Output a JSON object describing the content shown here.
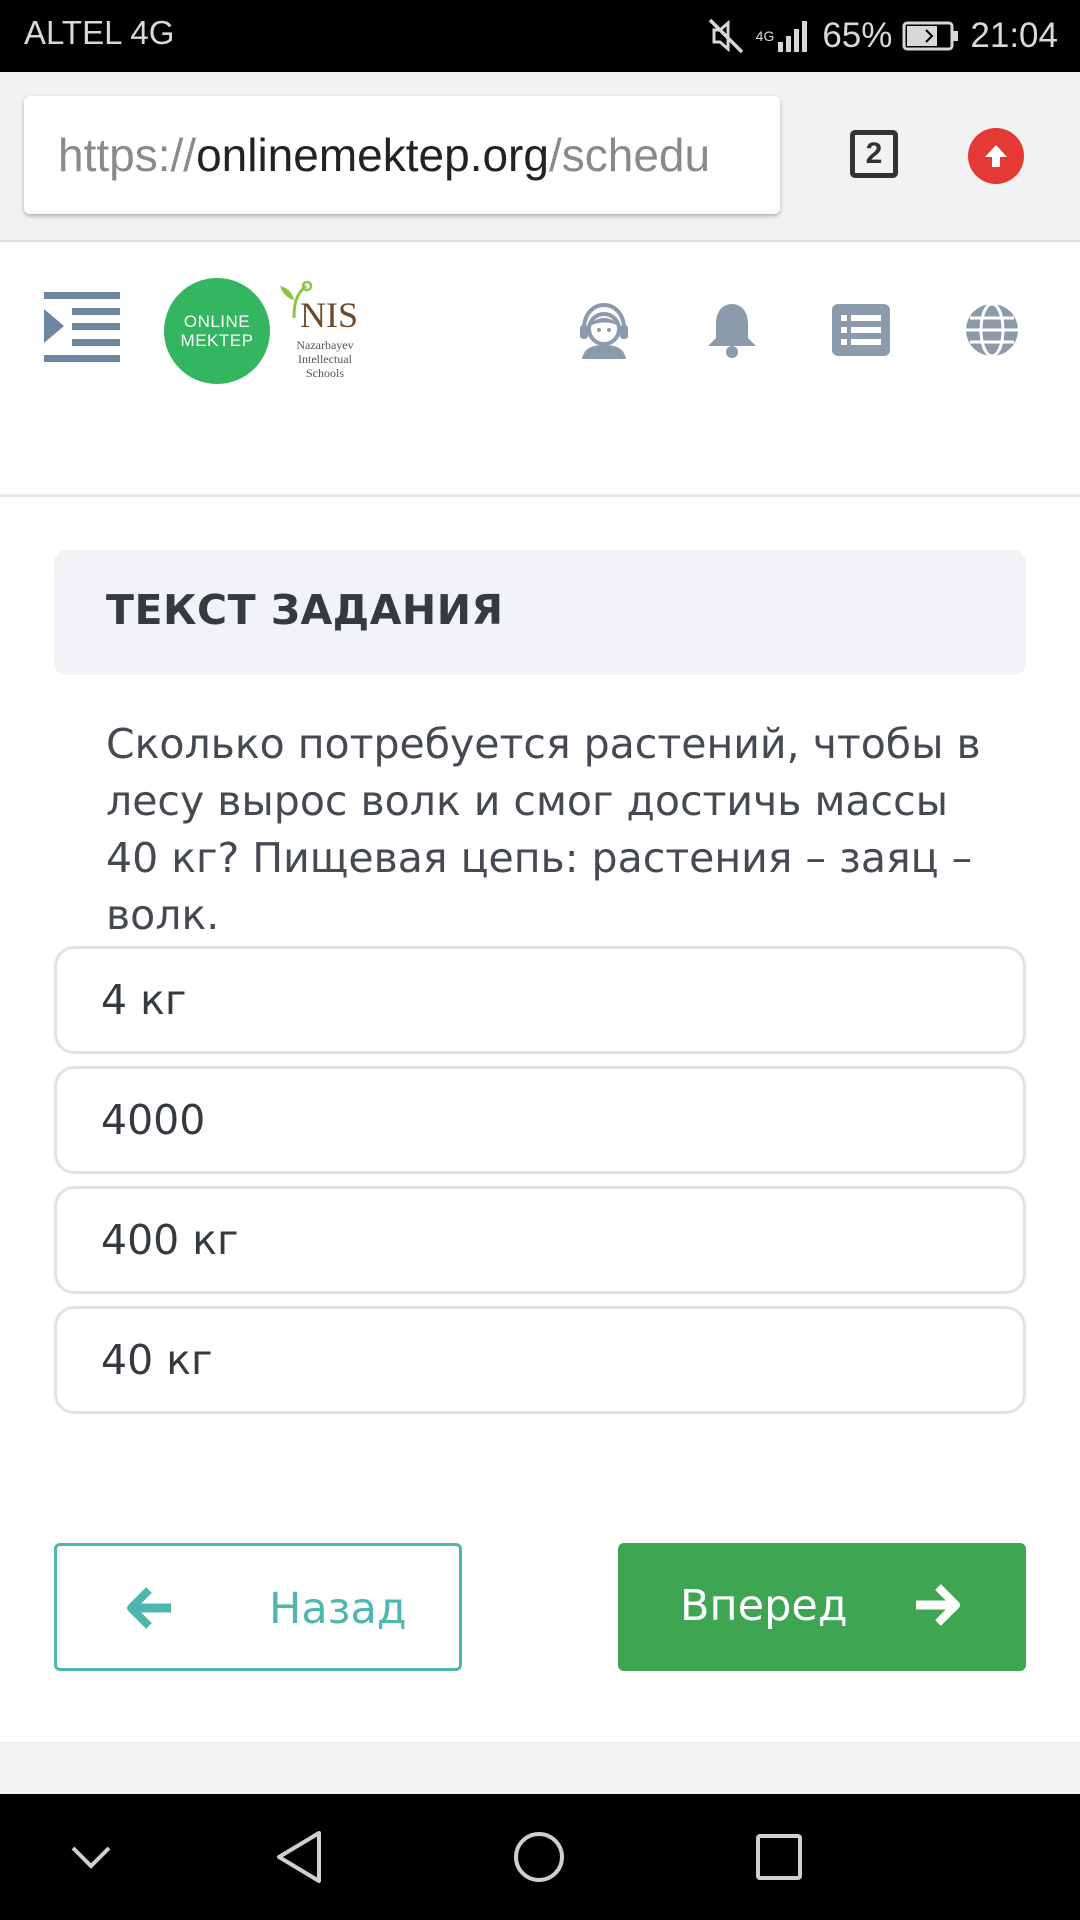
{
  "status_bar": {
    "carrier": "ALTEL 4G",
    "network_label": "4G",
    "battery": "65%",
    "time": "21:04"
  },
  "browser": {
    "url_scheme": "https://",
    "url_domain": "onlinemektep.org",
    "url_path": "/schedu",
    "tab_count": "2",
    "icons": [
      "tab-switcher-icon",
      "update-arrow-icon"
    ]
  },
  "header": {
    "logo_line1": "ONLINE",
    "logo_line2": "MEKTEP",
    "nis_title": "NIS",
    "nis_subtitle": "Nazarbayev Intellectual Schools",
    "icons": [
      "menu-toggle-icon",
      "support-agent-icon",
      "bell-icon",
      "list-icon",
      "globe-icon"
    ]
  },
  "task": {
    "section_title": "ТЕКСТ ЗАДАНИЯ",
    "question": "Сколько потребуется растений, чтобы в лесу вырос волк и смог достичь массы 40 кг? Пищевая цепь: растения – заяц – волк.",
    "answers": [
      "4 кг",
      "4000",
      "400 кг",
      "40 кг"
    ]
  },
  "navigation": {
    "back_label": "Назад",
    "next_label": "Вперед"
  },
  "colors": {
    "accent_green": "#3ea652",
    "back_teal": "#4fb7b0",
    "logo_green": "#33b65f",
    "update_red": "#e53935",
    "icon_gray": "#8b9bab"
  },
  "android_nav": {
    "icons": [
      "collapse-chevron-icon",
      "back-triangle-icon",
      "home-circle-icon",
      "recents-square-icon"
    ]
  }
}
